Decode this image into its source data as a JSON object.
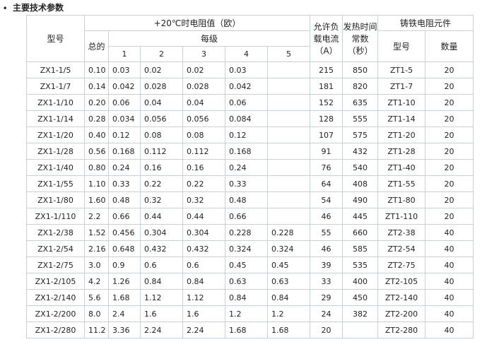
{
  "title": "主要技术参数",
  "header": {
    "model": "型号",
    "resistance_group": "+20℃时电阻值（欧）",
    "total": "总的",
    "per_stage": "每级",
    "stages": [
      "1",
      "2",
      "3",
      "4",
      "5"
    ],
    "current_1": "允许负",
    "current_2": "载电流",
    "current_3": "（A）",
    "heat_1": "发热时间",
    "heat_2": "常数",
    "heat_3": "（秒）",
    "element_group": "铸铁电阻元件",
    "element_model": "型号",
    "element_qty": "数量"
  },
  "rows": [
    [
      "ZX1-1/5",
      "0.10",
      "0.03",
      "0.02",
      "0.02",
      "0.03",
      "",
      "215",
      "850",
      "ZT1-5",
      "20"
    ],
    [
      "ZX1-1/7",
      "0.14",
      "0.042",
      "0.028",
      "0.028",
      "0.042",
      "",
      "181",
      "820",
      "ZT1-7",
      "20"
    ],
    [
      "ZX1-1/10",
      "0.20",
      "0.06",
      "0.04",
      "0.04",
      "0.06",
      "",
      "152",
      "635",
      "ZT1-10",
      "20"
    ],
    [
      "ZX1-1/14",
      "0.28",
      "0.034",
      "0.056",
      "0.056",
      "0.084",
      "",
      "128",
      "555",
      "ZT1-14",
      "20"
    ],
    [
      "ZX1-1/20",
      "0.40",
      "0.12",
      "0.08",
      "0.08",
      "0.12",
      "",
      "107",
      "575",
      "ZT1-20",
      "20"
    ],
    [
      "ZX1-1/28",
      "0.56",
      "0.168",
      "0.112",
      "0.112",
      "0.168",
      "",
      "91",
      "432",
      "ZT1-28",
      "20"
    ],
    [
      "ZX1-1/40",
      "0.80",
      "0.24",
      "0.16",
      "0.16",
      "0.24",
      "",
      "76",
      "540",
      "ZT1-40",
      "20"
    ],
    [
      "ZX1-1/55",
      "1.10",
      "0.33",
      "0.22",
      "0.22",
      "0.33",
      "",
      "64",
      "408",
      "ZT1-55",
      "20"
    ],
    [
      "ZX1-1/80",
      "1.60",
      "0.48",
      "0.32",
      "0.32",
      "0.48",
      "",
      "54",
      "490",
      "ZT1-80",
      "20"
    ],
    [
      "ZX1-1/110",
      "2.2",
      "0.66",
      "0.44",
      "0.44",
      "0.66",
      "",
      "46",
      "445",
      "ZT1-110",
      "20"
    ],
    [
      "ZX1-2/38",
      "1.52",
      "0.456",
      "0.304",
      "0.304",
      "0.228",
      "0.228",
      "55",
      "660",
      "ZT2-38",
      "40"
    ],
    [
      "ZX1-2/54",
      "2.16",
      "0.648",
      "0.432",
      "0.432",
      "0.324",
      "0.324",
      "46",
      "585",
      "ZT2-54",
      "40"
    ],
    [
      "ZX1-2/75",
      "3.0",
      "0.9",
      "0.6",
      "0.6",
      "0.45",
      "0.45",
      "39",
      "535",
      "ZT2-75",
      "40"
    ],
    [
      "ZX1-2/105",
      "4.2",
      "1.26",
      "0.84",
      "0.84",
      "0.63",
      "0.63",
      "33",
      "400",
      "ZT2-105",
      "40"
    ],
    [
      "ZX1-2/140",
      "5.6",
      "1.68",
      "1.12",
      "1.12",
      "0.84",
      "0.84",
      "29",
      "450",
      "ZT2-140",
      "40"
    ],
    [
      "ZX1-2/200",
      "8.0",
      "2.4",
      "1.6",
      "1.6",
      "1.2",
      "1.2",
      "24",
      "382",
      "ZT2-200",
      "40"
    ],
    [
      "ZX1-2/280",
      "11.2",
      "3.36",
      "2.24",
      "2.24",
      "1.68",
      "1.68",
      "20",
      "",
      "ZT2-280",
      "40"
    ]
  ]
}
